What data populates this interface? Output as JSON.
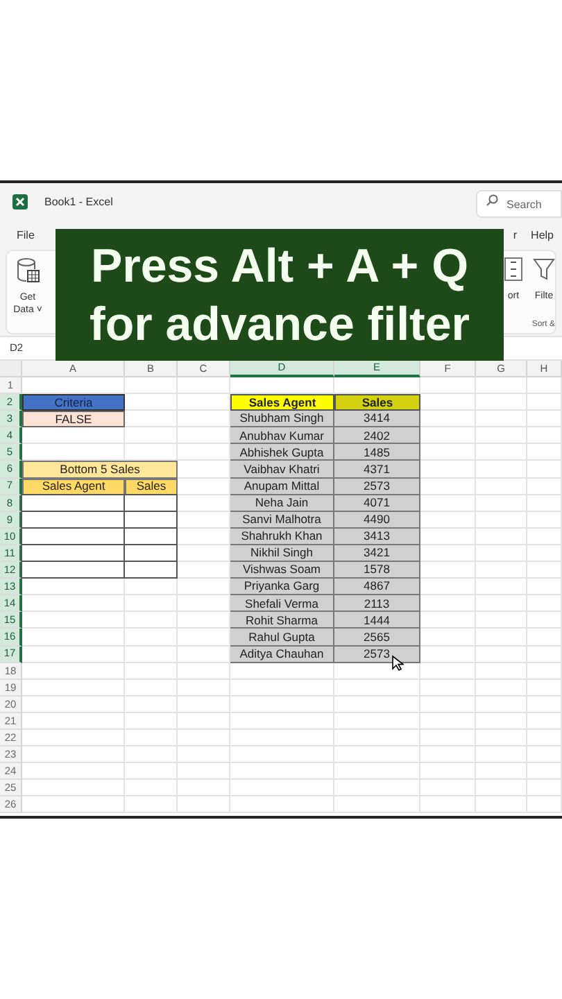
{
  "window": {
    "title": "Book1  -  Excel",
    "search": {
      "placeholder": "Search"
    }
  },
  "menu": [
    {
      "label": "File"
    },
    {
      "label": "r"
    },
    {
      "label": "Help"
    }
  ],
  "ribbon": {
    "left_button": {
      "label_1": "Get",
      "label_2": "Data",
      "caret": "˅"
    },
    "right_buttons": [
      {
        "kind": "sort",
        "label": "ort"
      },
      {
        "kind": "filter",
        "label": "Filte"
      }
    ],
    "group_label": "Sort &"
  },
  "banner": {
    "lines": [
      "Press Alt + A + Q",
      "for advance filter"
    ]
  },
  "name_box": "D2",
  "columns": [
    {
      "label": "A",
      "selected": false
    },
    {
      "label": "B",
      "selected": false
    },
    {
      "label": "C",
      "selected": false
    },
    {
      "label": "D",
      "selected": true
    },
    {
      "label": "E",
      "selected": true
    },
    {
      "label": "F",
      "selected": false
    },
    {
      "label": "G",
      "selected": false
    },
    {
      "label": "H",
      "selected": false
    }
  ],
  "rows": [
    {
      "label": "1",
      "selected": false
    },
    {
      "label": "2",
      "selected": true
    },
    {
      "label": "3",
      "selected": true
    },
    {
      "label": "4",
      "selected": true
    },
    {
      "label": "5",
      "selected": true
    },
    {
      "label": "6",
      "selected": true
    },
    {
      "label": "7",
      "selected": true
    },
    {
      "label": "8",
      "selected": true
    },
    {
      "label": "9",
      "selected": true
    },
    {
      "label": "10",
      "selected": true
    },
    {
      "label": "11",
      "selected": true
    },
    {
      "label": "12",
      "selected": true
    },
    {
      "label": "13",
      "selected": true
    },
    {
      "label": "14",
      "selected": true
    },
    {
      "label": "15",
      "selected": true
    },
    {
      "label": "16",
      "selected": true
    },
    {
      "label": "17",
      "selected": true
    },
    {
      "label": "18",
      "selected": false
    },
    {
      "label": "19",
      "selected": false
    },
    {
      "label": "20",
      "selected": false
    },
    {
      "label": "21",
      "selected": false
    },
    {
      "label": "22",
      "selected": false
    },
    {
      "label": "23",
      "selected": false
    },
    {
      "label": "24",
      "selected": false
    },
    {
      "label": "25",
      "selected": false
    },
    {
      "label": "26",
      "selected": false
    }
  ],
  "criteria": {
    "header": "Criteria",
    "value": "FALSE"
  },
  "bottom_table": {
    "title": "Bottom 5 Sales",
    "columns": [
      "Sales Agent",
      "Sales"
    ]
  },
  "sales_table": {
    "columns": [
      "Sales Agent",
      "Sales"
    ],
    "rows": [
      [
        "Shubham Singh",
        "3414"
      ],
      [
        "Anubhav Kumar",
        "2402"
      ],
      [
        "Abhishek Gupta",
        "1485"
      ],
      [
        "Vaibhav Khatri",
        "4371"
      ],
      [
        "Anupam Mittal",
        "2573"
      ],
      [
        "Neha Jain",
        "4071"
      ],
      [
        "Sanvi Malhotra",
        "4490"
      ],
      [
        "Shahrukh Khan",
        "3413"
      ],
      [
        "Nikhil Singh",
        "3421"
      ],
      [
        "Vishwas Soam",
        "1578"
      ],
      [
        "Priyanka Garg",
        "4867"
      ],
      [
        "Shefali Verma",
        "2113"
      ],
      [
        "Rohit Sharma",
        "1444"
      ],
      [
        "Rahul Gupta",
        "2565"
      ],
      [
        "Aditya Chauhan",
        "2573"
      ]
    ]
  }
}
